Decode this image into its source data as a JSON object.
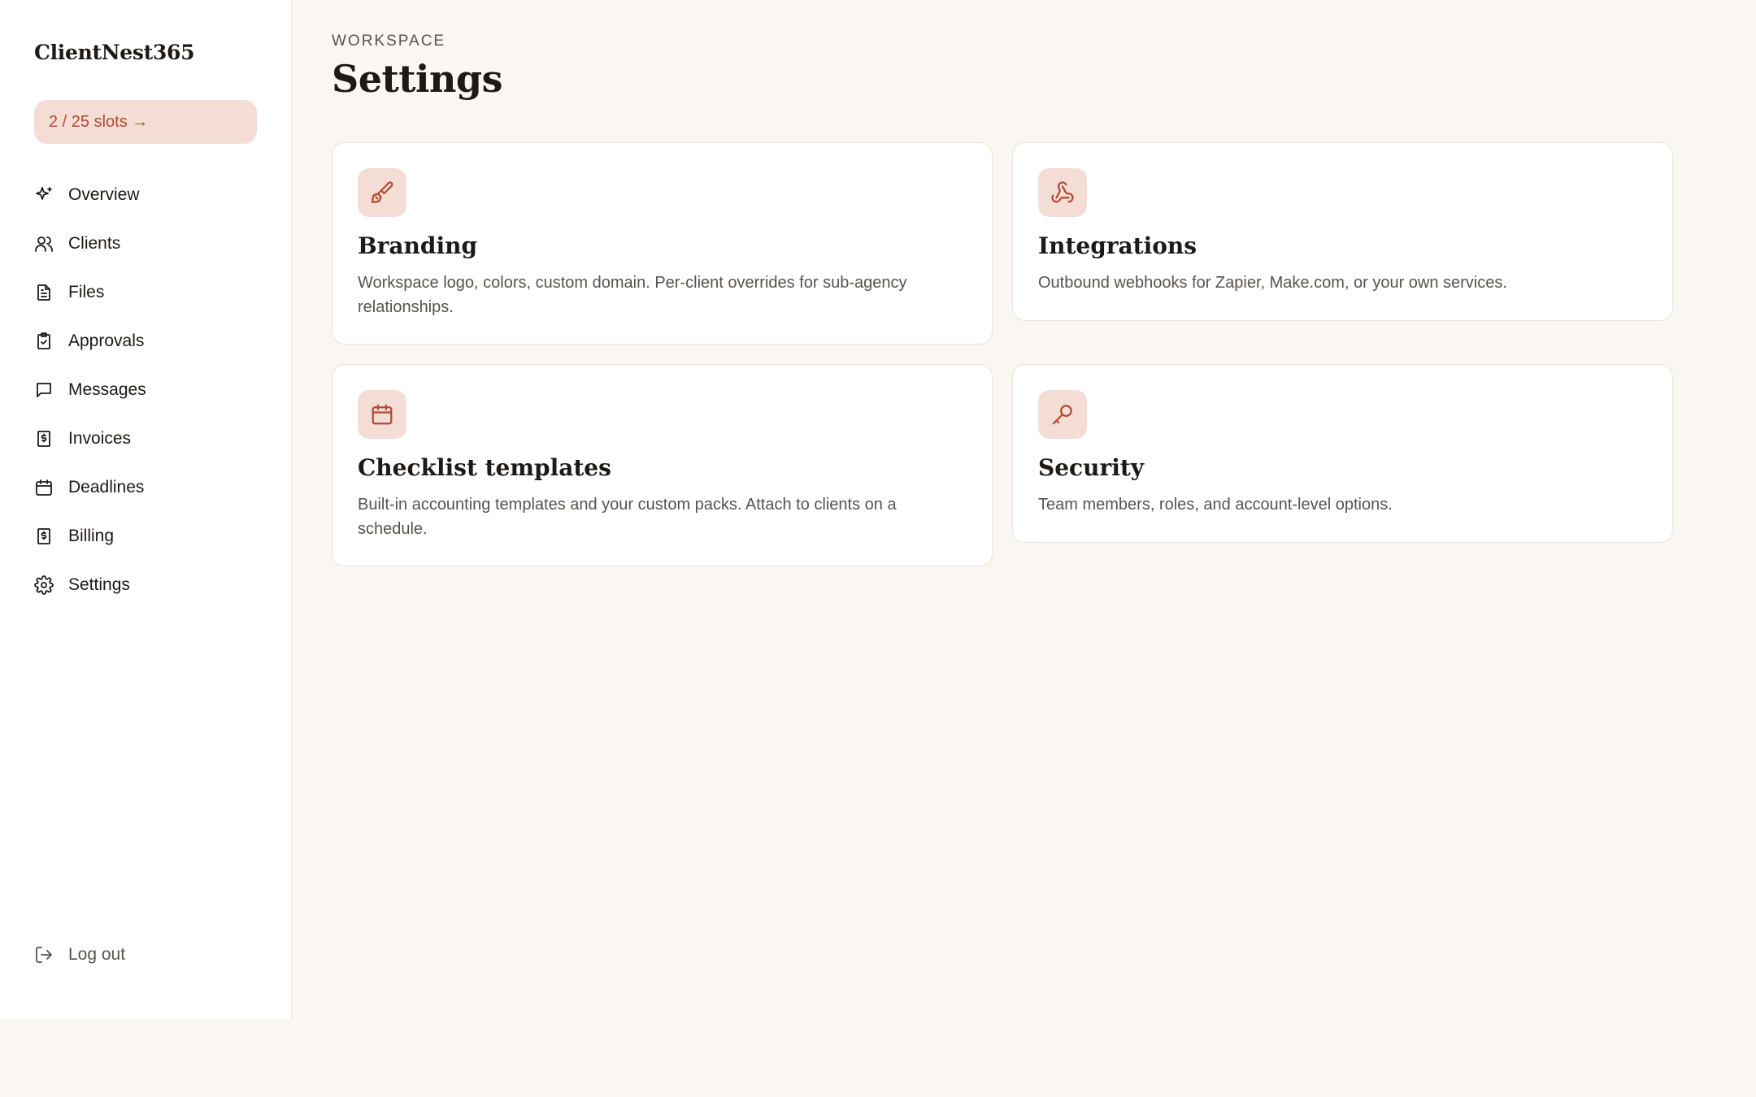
{
  "sidebar": {
    "brand": "ClientNest365",
    "slots_label": "2 / 25 slots →",
    "items": [
      {
        "label": "Overview",
        "icon": "sparkle-icon"
      },
      {
        "label": "Clients",
        "icon": "users-icon"
      },
      {
        "label": "Files",
        "icon": "file-icon"
      },
      {
        "label": "Approvals",
        "icon": "clipboard-check-icon"
      },
      {
        "label": "Messages",
        "icon": "message-icon"
      },
      {
        "label": "Invoices",
        "icon": "invoice-icon"
      },
      {
        "label": "Deadlines",
        "icon": "calendar-icon"
      },
      {
        "label": "Billing",
        "icon": "billing-icon"
      },
      {
        "label": "Settings",
        "icon": "gear-icon"
      }
    ],
    "logout_label": "Log out"
  },
  "header": {
    "eyebrow": "WORKSPACE",
    "title": "Settings"
  },
  "cards": [
    {
      "title": "Branding",
      "description": "Workspace logo, colors, custom domain. Per-client overrides for sub-agency relationships.",
      "icon": "paintbrush-icon"
    },
    {
      "title": "Integrations",
      "description": "Outbound webhooks for Zapier, Make.com, or your own services.",
      "icon": "webhook-icon"
    },
    {
      "title": "Checklist templates",
      "description": "Built-in accounting templates and your custom packs. Attach to clients on a schedule.",
      "icon": "calendar-icon"
    },
    {
      "title": "Security",
      "description": "Team members, roles, and account-level options.",
      "icon": "key-icon"
    }
  ],
  "colors": {
    "accent": "#b24a34",
    "accent_bg": "#f3ddd5",
    "page_bg": "#faf7f2"
  }
}
